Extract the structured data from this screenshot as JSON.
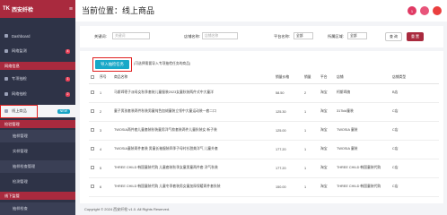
{
  "brand": {
    "logo": "TK",
    "name": "西安纤检",
    "menu_icon": "hamburger-icon"
  },
  "sidebar": {
    "items": [
      {
        "label": "Dashboard",
        "icon": "dashboard-icon"
      },
      {
        "label": "网络监测",
        "badge": "4"
      }
    ],
    "section1": "网络信息",
    "items2": [
      {
        "label": "专项抽检",
        "badge": "1"
      },
      {
        "label": "网络抽检",
        "badge": "2"
      },
      {
        "label": "线上商品",
        "badge": "NEW"
      }
    ],
    "section2": "检验管理",
    "subs": [
      "抽样管理",
      "实样管理",
      "抽样检查管理",
      "检测管理"
    ],
    "section3": "线下监管",
    "subs2": [
      "抽样检查"
    ]
  },
  "header": {
    "title": "当前位置：线上商品",
    "avatars": [
      "1",
      "",
      ""
    ]
  },
  "filter": {
    "keyword_label": "关键词:",
    "keyword_placeholder": "关键词",
    "shop_label": "店铺名称:",
    "shop_placeholder": "店铺名称",
    "platform_label": "平台名称:",
    "platform_value": "全部",
    "region_label": "所属区域:",
    "region_value": "全部",
    "query": "查 询",
    "reset": "重 置"
  },
  "panel": {
    "download_btn": "导入抽检任务",
    "note": "(可选择需要导入专项抽检任务的商品)",
    "columns": [
      "序号",
      "商品名称",
      "销量价格",
      "销量",
      "平台",
      "店铺",
      "店铺类型"
    ],
    "rows": [
      [
        "1",
        "马斯缔枣子派母女秋季套装儿童服装2023女童秋装两件式中大童洋",
        "58.50",
        "2",
        "淘宝",
        "柯斯缔旗",
        "B店"
      ],
      [
        "2",
        "童子男孩套装两件秋装男童纯色加绒童装立领中大童运动装一套二口",
        "125.30",
        "1",
        "淘宝",
        "317kid童装",
        "C店"
      ],
      [
        "3",
        "TWOSIA两件套儿童套装秋装童男洋气款套装两件儿童秋装女 新子装",
        "125.00",
        "1",
        "淘宝",
        "TWOSIA 童装",
        "C店"
      ],
      [
        "4",
        "TWOSIA童装两件套装 男童长袖服装四季子母衬衫甜美洋气 儿童外套",
        "177.20",
        "1",
        "淘宝",
        "TWOSIA 童装",
        "C店"
      ],
      [
        "5",
        "THREE CHILD 韩国童装代购 儿童套装秋季女童男童两件套 洋气秋装",
        "177.20",
        "1",
        "淘宝",
        "THREE CHILD 韩国童装代购",
        "C店"
      ],
      [
        "6",
        "THREE CHILD 韩国童装代购 儿童冬季套装男女童加厚保暖两件套秋装",
        "150.00",
        "1",
        "淘宝",
        "THREE CHILD 韩国童装代购",
        "C店"
      ]
    ]
  },
  "footer": "Copyright © 2024 西安纤检 v1.0. All Rights Reserved."
}
